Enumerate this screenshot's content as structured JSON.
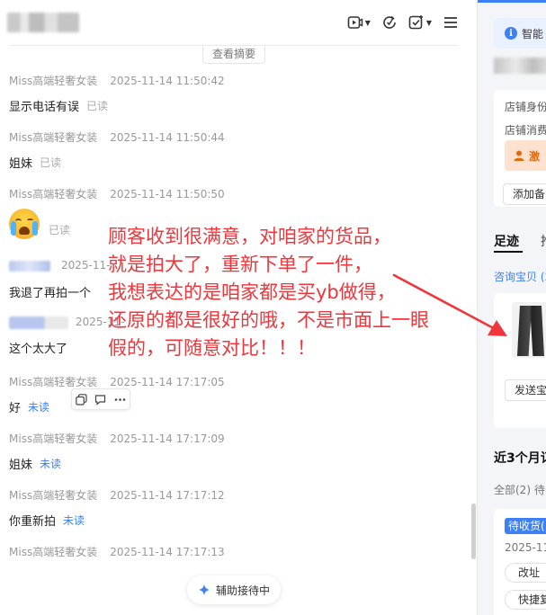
{
  "header": {
    "summary_label": "查看摘要"
  },
  "messages": [
    {
      "sender": "Miss高端轻奢女装",
      "time": "2025-11-14 11:50:42",
      "text": "显示电话有误",
      "status": "已读"
    },
    {
      "sender": "Miss高端轻奢女装",
      "time": "2025-11-14 11:50:44",
      "text": "姐妹",
      "status": "已读"
    },
    {
      "sender": "Miss高端轻奢女装",
      "time": "2025-11-14 11:50:50",
      "emoji": "crying-face",
      "status": "已读"
    },
    {
      "sender_blurred": true,
      "time": "2025-11-",
      "text": "我退了再拍一个"
    },
    {
      "sender_blurred": true,
      "time": "2025-11-",
      "text": "这个太大了"
    },
    {
      "sender": "Miss高端轻奢女装",
      "time": "2025-11-14 17:17:05",
      "text": "好",
      "status": "未读"
    },
    {
      "sender": "Miss高端轻奢女装",
      "time": "2025-11-14 17:17:09",
      "text": "姐妹",
      "status": "未读"
    },
    {
      "sender": "Miss高端轻奢女装",
      "time": "2025-11-14 17:17:12",
      "text": "你重新拍",
      "status": "未读"
    },
    {
      "sender": "Miss高端轻奢女装",
      "time": "2025-11-14 17:17:13"
    }
  ],
  "annotation": {
    "lines": [
      "顾客收到很满意，对咱家的货品，",
      "就是拍大了，重新下单了一件，",
      "我想表达的是咱家都是买yb做得，",
      "还原的都是很好的哦，不是市面上一眼",
      "假的，可随意对比！！！"
    ],
    "color": "#f0353b"
  },
  "assist_button": {
    "label": "辅助接待中"
  },
  "right_panel": {
    "smart_label": "智能",
    "store_identity": "店铺身份",
    "store_consume": "店铺消费",
    "orange_tag": "激",
    "add_note": "添加备",
    "tab_active": "足迹",
    "tab_other": "推",
    "inquiry_link": "咨询宝贝 (2",
    "send_product": "发送宝",
    "orders_title": "近3个月订",
    "orders_filter": "全部(2)  待",
    "order_badge": "待收货(",
    "order_date": "2025-11-",
    "order_btn_1": "改址",
    "order_btn_2": "快捷复"
  },
  "colors": {
    "accent": "#3d7ff5",
    "unread": "#3d7ff5",
    "read": "#aaaaaa"
  }
}
